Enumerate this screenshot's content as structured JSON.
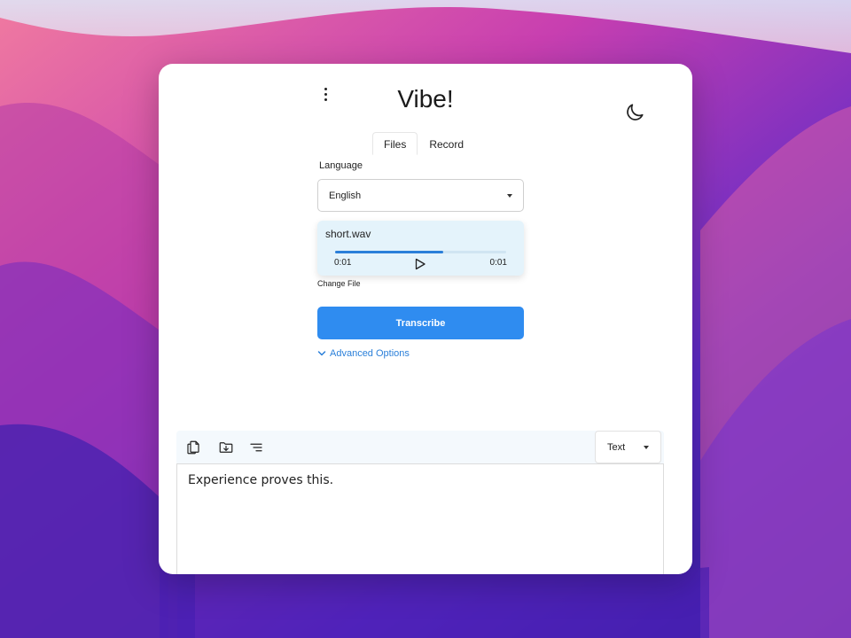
{
  "app": {
    "title": "Vibe!"
  },
  "tabs": [
    {
      "label": "Files",
      "active": true
    },
    {
      "label": "Record",
      "active": false
    }
  ],
  "language": {
    "label": "Language",
    "value": "English"
  },
  "audio": {
    "file_name": "short.wav",
    "current_time": "0:01",
    "total_time": "0:01",
    "progress": 0.63
  },
  "actions": {
    "change_file": "Change File",
    "transcribe": "Transcribe",
    "advanced_options": "Advanced Options"
  },
  "output": {
    "format": "Text",
    "text": "Experience proves this."
  },
  "colors": {
    "accent": "#2f8cf0",
    "link": "#2a7fd9",
    "audio_card_bg": "#e4f3fb"
  },
  "icons": {
    "menu": "more-vertical-icon",
    "theme": "moon-icon",
    "play": "play-icon",
    "copy": "copy-icon",
    "save": "folder-download-icon",
    "format": "align-right-icon",
    "advanced": "chevron-down-icon"
  }
}
